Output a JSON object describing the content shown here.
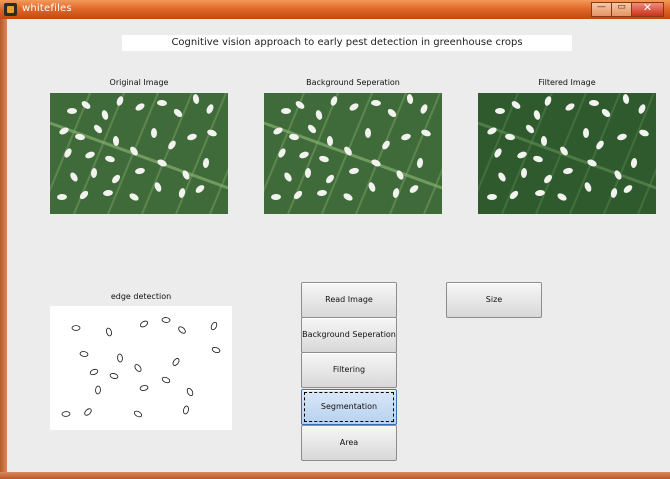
{
  "window": {
    "title": "whitefiles",
    "minimize_glyph": "—",
    "maximize_glyph": "▭",
    "close_glyph": "✕"
  },
  "heading": "Cognitive vision approach to early pest detection in greenhouse crops",
  "panels": [
    {
      "caption": "Original Image",
      "icon": "leaf-image",
      "variant": "original"
    },
    {
      "caption": "Background Seperation",
      "icon": "leaf-image",
      "variant": "original"
    },
    {
      "caption": "Filtered Image",
      "icon": "leaf-image",
      "variant": "filtered"
    }
  ],
  "edge": {
    "caption": "edge detection",
    "icon": "edge-image"
  },
  "buttons": {
    "read_image": "Read Image",
    "background_separation": "Background Seperation",
    "filtering": "Filtering",
    "segmentation": "Segmentation",
    "area": "Area",
    "size": "Size"
  },
  "colors": {
    "titlebar": "#e06a2a",
    "leaf": "#3f6b3a",
    "leaf_filtered": "#2f5a2e",
    "pest": "#f2f2ee",
    "focused_button": "#b6d1ef"
  }
}
